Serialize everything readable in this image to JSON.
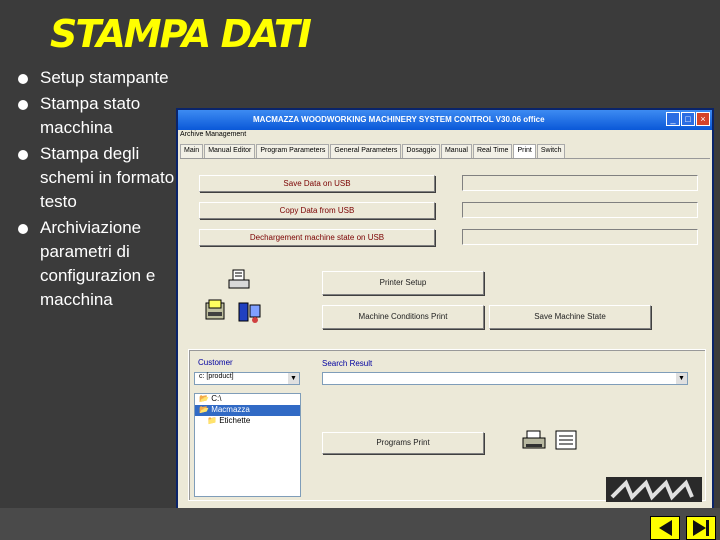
{
  "slide": {
    "title": "STAMPA DATI",
    "bullets": [
      "Setup stampante",
      "Stampa stato macchina",
      "Stampa degli schemi in formato testo",
      "Archiviazione parametri di configurazion e macchina"
    ]
  },
  "window": {
    "title": "MACMAZZA WOODWORKING MACHINERY SYSTEM CONTROL  V30.06 office",
    "menu": "Archive Management",
    "title_buttons": [
      "_",
      "□",
      "×"
    ],
    "tabs": [
      "Main",
      "Manual Editor",
      "Program Parameters",
      "General Parameters",
      "Dosaggio",
      "Manual",
      "Real Time",
      "Print",
      "Switch"
    ],
    "active_tab": "Print",
    "buttons": {
      "save_usb": "Save Data on USB",
      "copy_usb": "Copy Data from USB",
      "decharge": "Dechargement machine state on USB",
      "printer_setup": "Printer Setup",
      "machine_conditions": "Machine Conditions Print",
      "save_machine_state": "Save Machine State",
      "programs_print": "Programs Print"
    },
    "customer": {
      "label": "Customer",
      "drive_value": "c: [product]",
      "tree": [
        "C:\\",
        "Macmazza",
        "Etichette"
      ],
      "selected": "Macmazza"
    },
    "search": {
      "label": "Search Result",
      "value": ""
    }
  },
  "colors": {
    "title": "#ffff00",
    "background": "#3b3b3b",
    "titlebar": "#0a58d8"
  }
}
